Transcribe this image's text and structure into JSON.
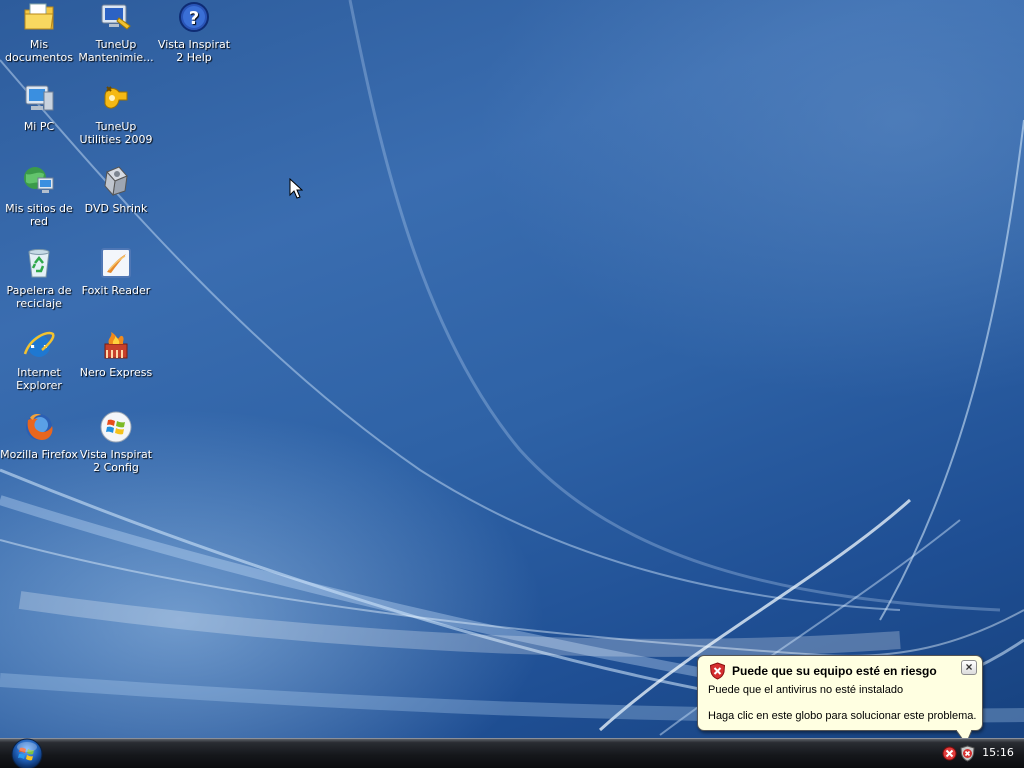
{
  "desktop": {
    "icons": [
      {
        "label": "Mis documentos",
        "icon": "folder-documents-icon"
      },
      {
        "label": "TuneUp Mantenimie...",
        "icon": "tuneup-maintenance-icon"
      },
      {
        "label": "Vista Inspirat 2 Help",
        "icon": "help-icon"
      },
      {
        "label": "Mi PC",
        "icon": "computer-icon"
      },
      {
        "label": "TuneUp Utilities 2009",
        "icon": "tuneup-utilities-icon"
      },
      {
        "label": "Mis sitios de red",
        "icon": "network-places-icon"
      },
      {
        "label": "DVD Shrink",
        "icon": "dvd-shrink-icon"
      },
      {
        "label": "Papelera de reciclaje",
        "icon": "recycle-bin-icon"
      },
      {
        "label": "Foxit Reader",
        "icon": "foxit-reader-icon"
      },
      {
        "label": "Internet Explorer",
        "icon": "internet-explorer-icon"
      },
      {
        "label": "Nero Express",
        "icon": "nero-express-icon"
      },
      {
        "label": "Mozilla Firefox",
        "icon": "firefox-icon"
      },
      {
        "label": "Vista Inspirat 2 Config",
        "icon": "windows-logo-icon"
      }
    ]
  },
  "taskbar": {
    "clock": "15:16",
    "tray_icons": [
      "security-alert-icon",
      "security-shield-icon"
    ]
  },
  "balloon": {
    "title": "Puede que su equipo esté en riesgo",
    "line1": "Puede que el antivirus no esté instalado",
    "line2": "Haga clic en este globo para solucionar este problema.",
    "close_label": "×"
  },
  "colors": {
    "desktop_blue": "#2e62a6",
    "balloon_bg": "#ffffe1",
    "alert_red": "#d62f2f"
  }
}
